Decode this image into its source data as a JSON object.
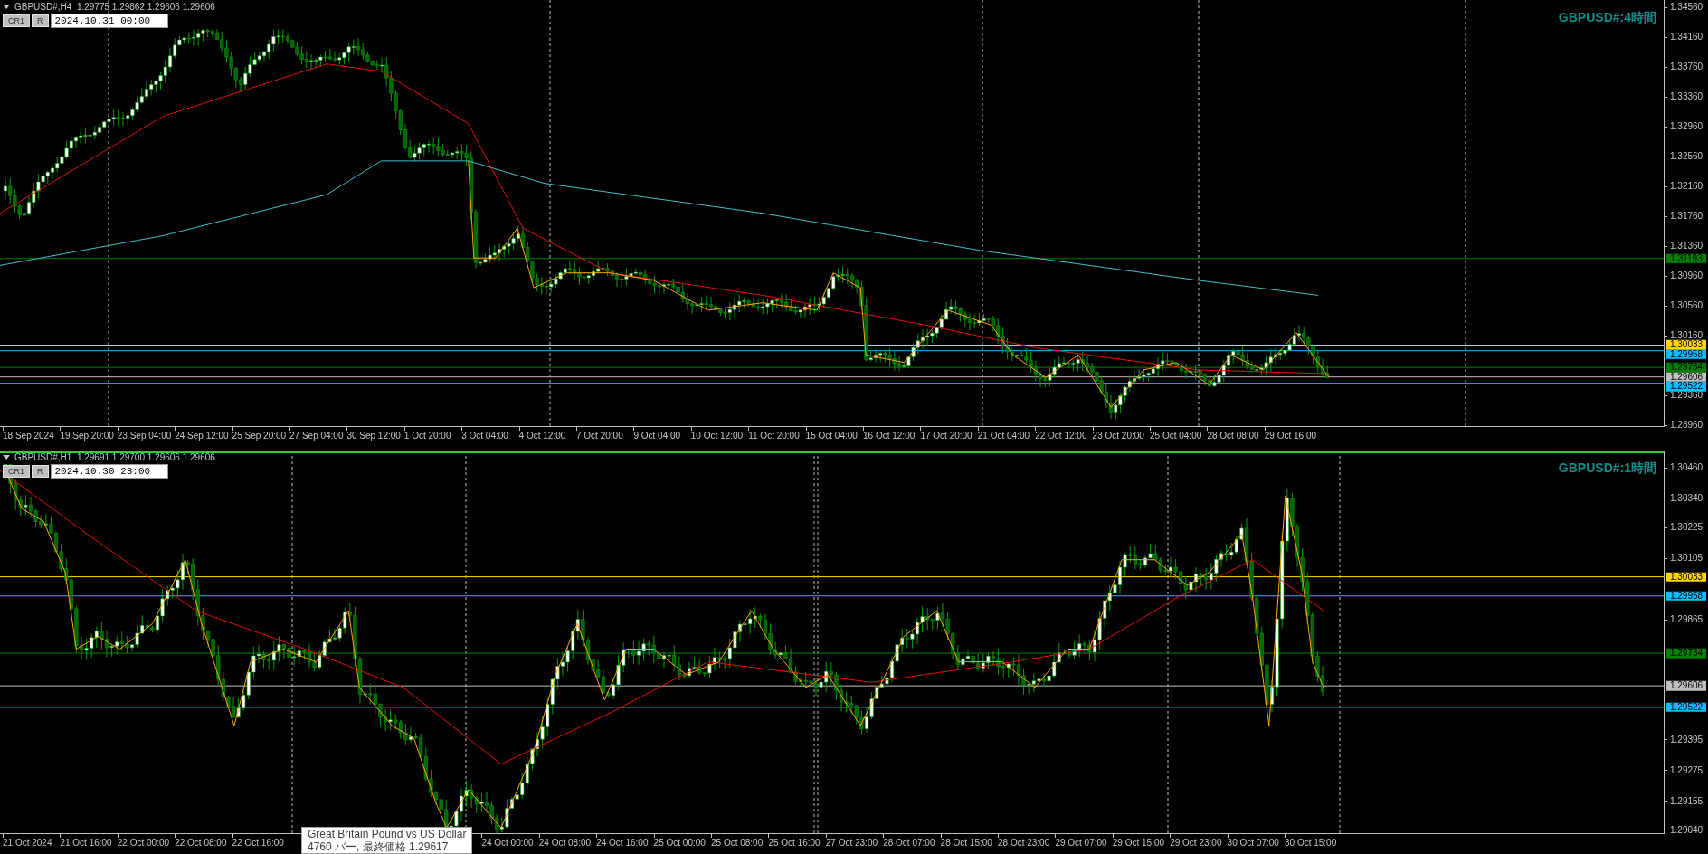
{
  "charts": [
    {
      "active": false,
      "symbol_info": "GBPUSD#,H4  1.29775 1.29862 1.29606 1.29606",
      "buttons": [
        "CR1",
        "R"
      ],
      "date_field": "2024.10.31 00:00",
      "title_label": "GBPUSD#:4時間",
      "price_ticks": [
        "1.34560",
        "1.34160",
        "1.33760",
        "1.33360",
        "1.32960",
        "1.32560",
        "1.32160",
        "1.31760",
        "1.31360",
        "1.30960",
        "1.30560",
        "1.30160",
        "1.29360",
        "1.28960"
      ],
      "price_lines": [
        {
          "label": "1.31193",
          "color": "#008000"
        },
        {
          "label": "1.30033",
          "color": "#ffd700"
        },
        {
          "label": "1.29958",
          "color": "#00bfff"
        },
        {
          "label": "1.29734",
          "color": "#008000"
        },
        {
          "label": "1.29606",
          "color": "#c0c0c0"
        },
        {
          "label": "1.29522",
          "color": "#00bfff"
        }
      ],
      "time_labels": [
        "18 Sep 2024",
        "19 Sep 20:00",
        "23 Sep 04:00",
        "24 Sep 12:00",
        "25 Sep 20:00",
        "27 Sep 04:00",
        "30 Sep 12:00",
        "1 Oct 20:00",
        "3 Oct 04:00",
        "4 Oct 12:00",
        "7 Oct 20:00",
        "9 Oct 04:00",
        "10 Oct 12:00",
        "11 Oct 20:00",
        "15 Oct 04:00",
        "16 Oct 12:00",
        "17 Oct 20:00",
        "21 Oct 04:00",
        "22 Oct 12:00",
        "23 Oct 20:00",
        "25 Oct 04:00",
        "28 Oct 08:00",
        "29 Oct 16:00"
      ]
    },
    {
      "active": true,
      "symbol_info": "GBPUSD#,H1  1.29691 1.29700 1.29606 1.29606",
      "buttons": [
        "CR1",
        "R"
      ],
      "date_field": "2024.10.30 23:00",
      "title_label": "GBPUSD#:1時間",
      "price_ticks": [
        "1.30460",
        "1.30340",
        "1.30225",
        "1.30105",
        "1.29865",
        "1.29395",
        "1.29275",
        "1.29155",
        "1.29040"
      ],
      "price_lines": [
        {
          "label": "1.30033",
          "color": "#ffd700"
        },
        {
          "label": "1.29958",
          "color": "#00bfff"
        },
        {
          "label": "1.29734",
          "color": "#008000"
        },
        {
          "label": "1.29606",
          "color": "#c0c0c0"
        },
        {
          "label": "1.29522",
          "color": "#00bfff"
        }
      ],
      "time_labels": [
        "21 Oct 2024",
        "21 Oct 16:00",
        "22 Oct 00:00",
        "22 Oct 08:00",
        "22 Oct 16:00",
        "24 Oct 00:00",
        "24 Oct 08:00",
        "24 Oct 16:00",
        "25 Oct 00:00",
        "25 Oct 08:00",
        "25 Oct 16:00",
        "27 Oct 23:00",
        "28 Oct 07:00",
        "28 Oct 15:00",
        "28 Oct 23:00",
        "29 Oct 07:00",
        "29 Oct 15:00",
        "29 Oct 23:00",
        "30 Oct 07:00",
        "30 Oct 15:00"
      ]
    }
  ],
  "tooltip": {
    "title": "Great Britain Pound vs US Dollar",
    "detail": "4760 バー, 最終価格 1.29617"
  }
}
